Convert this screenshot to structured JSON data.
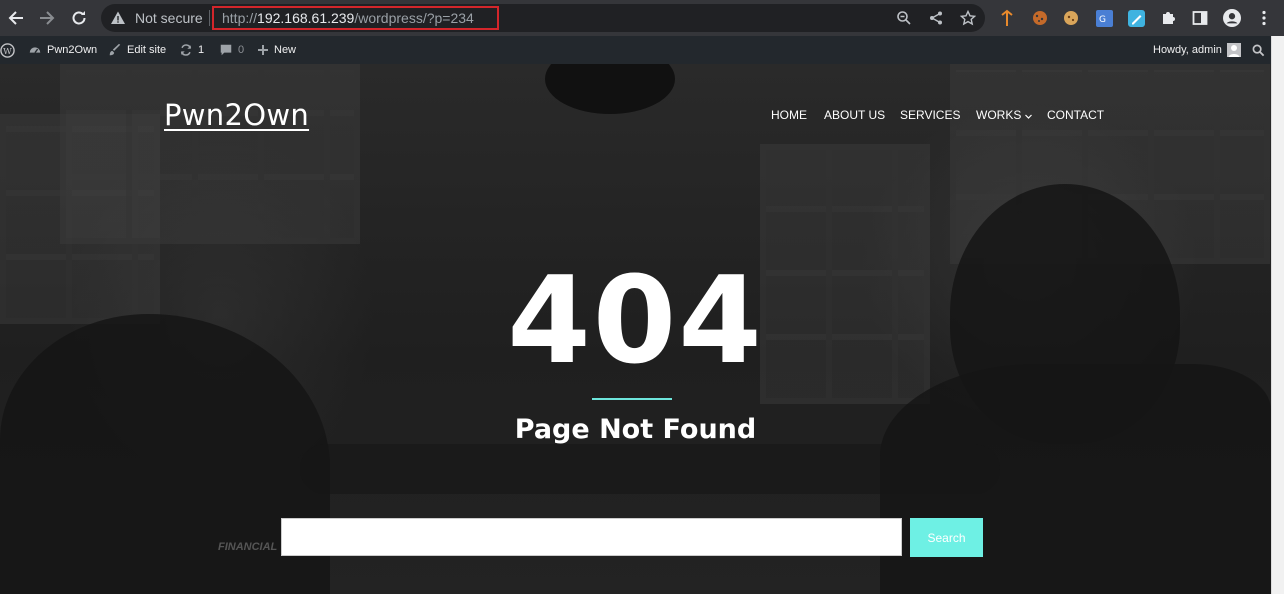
{
  "browser": {
    "security_label": "Not secure",
    "url_scheme": "http://",
    "url_host": "192.168.61.239",
    "url_path": "/wordpress/?p=234"
  },
  "admin_bar": {
    "site_name": "Pwn2Own",
    "edit_site": "Edit site",
    "updates_count": "1",
    "comments_count": "0",
    "new_label": "New",
    "greeting": "Howdy, admin"
  },
  "site": {
    "title": "Pwn2Own",
    "menu": {
      "home": "HOME",
      "about": "ABOUT US",
      "services": "SERVICES",
      "works": "WORKS",
      "contact": "CONTACT"
    }
  },
  "error": {
    "code": "404",
    "message": "Page Not Found",
    "photo_caption": "FINANCIAL"
  },
  "search": {
    "placeholder": "",
    "button_label": "Search"
  },
  "colors": {
    "accent": "#6ef0e4",
    "url_highlight": "#d4262b"
  }
}
